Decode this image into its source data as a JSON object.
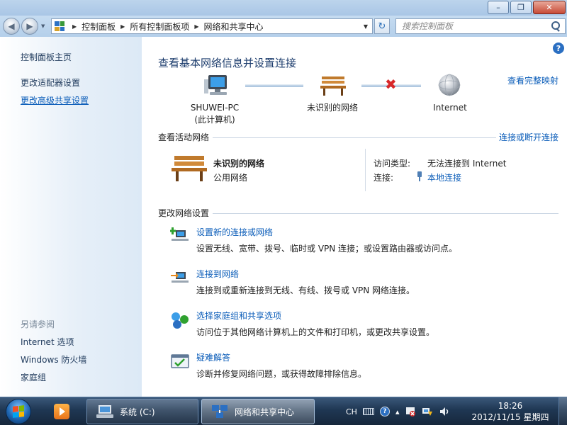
{
  "window": {
    "minimize": "–",
    "maximize": "❐",
    "close": "✕"
  },
  "navigation": {
    "back_icon": "back-arrow-icon",
    "forward_icon": "forward-arrow-icon",
    "breadcrumbs": [
      "控制面板",
      "所有控制面板项",
      "网络和共享中心"
    ],
    "search_placeholder": "搜索控制面板"
  },
  "sidebar": {
    "items": [
      {
        "label": "控制面板主页"
      },
      {
        "label": "更改适配器设置"
      },
      {
        "label": "更改高级共享设置"
      }
    ],
    "see_also_heading": "另请参阅",
    "see_also": [
      {
        "label": "Internet 选项"
      },
      {
        "label": "Windows 防火墙"
      },
      {
        "label": "家庭组"
      }
    ]
  },
  "main": {
    "title": "查看基本网络信息并设置连接",
    "see_full_map": "查看完整映射",
    "map": {
      "computer_name": "SHUWEI-PC",
      "computer_caption": "(此计算机)",
      "network": "未识别的网络",
      "internet": "Internet"
    },
    "active_networks": {
      "heading": "查看活动网络",
      "connect_link": "连接或断开连接",
      "network_name": "未识别的网络",
      "network_category": "公用网络",
      "access_type_label": "访问类型:",
      "access_type_value": "无法连接到 Internet",
      "connections_label": "连接:",
      "connections_value": "本地连接"
    },
    "change_settings": {
      "heading": "更改网络设置",
      "tasks": [
        {
          "title": "设置新的连接或网络",
          "description": "设置无线、宽带、拨号、临时或 VPN 连接；或设置路由器或访问点。",
          "icon": "new-connection-icon"
        },
        {
          "title": "连接到网络",
          "description": "连接到或重新连接到无线、有线、拨号或 VPN 网络连接。",
          "icon": "connect-network-icon"
        },
        {
          "title": "选择家庭组和共享选项",
          "description": "访问位于其他网络计算机上的文件和打印机，或更改共享设置。",
          "icon": "homegroup-icon"
        },
        {
          "title": "疑难解答",
          "description": "诊断并修复网络问题，或获得故障排除信息。",
          "icon": "troubleshoot-icon"
        }
      ]
    }
  },
  "taskbar": {
    "tasks": [
      {
        "label": "系统 (C:)"
      },
      {
        "label": "网络和共享中心"
      }
    ],
    "tray": {
      "lang": "CH"
    },
    "clock": {
      "time": "18:26",
      "date": "2012/11/15 星期四"
    }
  }
}
